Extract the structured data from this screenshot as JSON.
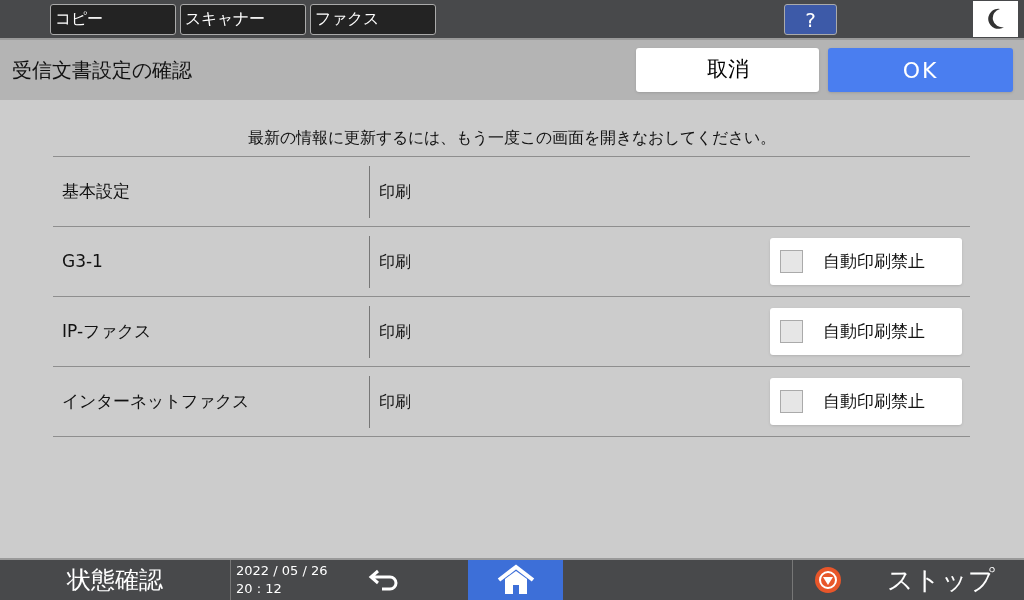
{
  "top_tabs": [
    {
      "label": "コピー"
    },
    {
      "label": "スキャナー"
    },
    {
      "label": "ファクス"
    }
  ],
  "help_button": "?",
  "header": {
    "title": "受信文書設定の確認",
    "cancel": "取消",
    "ok": "OK"
  },
  "message": "最新の情報に更新するには、もう一度この画面を開きなおしてください。",
  "rows": [
    {
      "name": "基本設定",
      "value": "印刷"
    },
    {
      "name": "G3-1",
      "value": "印刷",
      "option": {
        "label": "自動印刷禁止",
        "checked": false
      }
    },
    {
      "name": "IP-ファクス",
      "value": "印刷",
      "option": {
        "label": "自動印刷禁止",
        "checked": false
      }
    },
    {
      "name": "インターネットファクス",
      "value": "印刷",
      "option": {
        "label": "自動印刷禁止",
        "checked": false
      }
    }
  ],
  "status_bar": {
    "status": "状態確認",
    "date": "2022 / 05 / 26",
    "time": "20 : 12",
    "stop": "ストップ"
  }
}
